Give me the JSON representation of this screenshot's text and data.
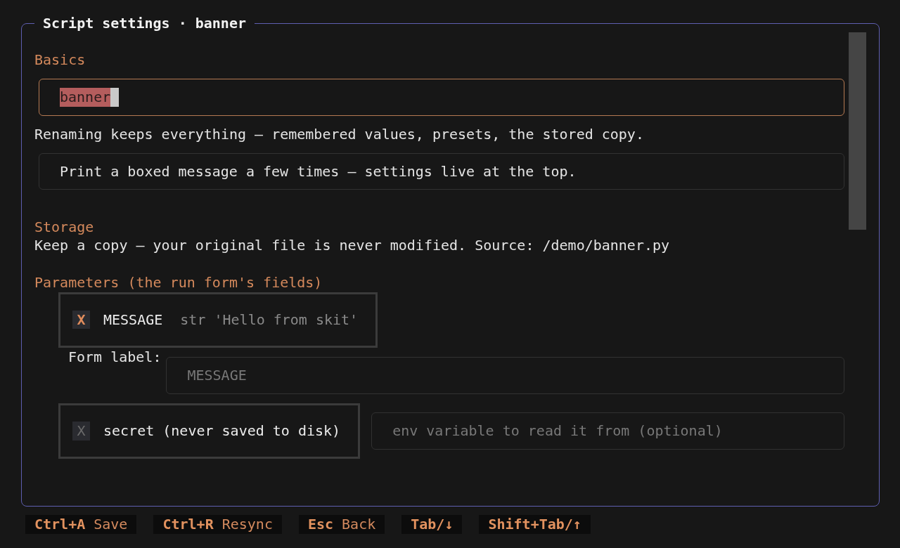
{
  "panel": {
    "title": "Script settings · banner"
  },
  "basics": {
    "heading": "Basics",
    "name_field": {
      "value": "banner",
      "focused": true,
      "text_selected": true
    },
    "rename_note": "Renaming keeps everything — remembered values, presets, the stored copy.",
    "description_field": {
      "value": "Print a boxed message a few times — settings live at the top.",
      "focused": false
    }
  },
  "storage": {
    "heading": "Storage",
    "note": "Keep a copy — your original file is never modified. Source: /demo/banner.py"
  },
  "parameters": {
    "heading": "Parameters (the run form's fields)",
    "items": [
      {
        "include": {
          "glyph": "X",
          "checked": true,
          "name": "MESSAGE",
          "hint": "str 'Hello from skit'"
        },
        "form_label": {
          "label": "Form label:",
          "placeholder": "MESSAGE"
        },
        "secret": {
          "glyph": "X",
          "checked": false,
          "label": "secret (never saved to disk)"
        },
        "env_field": {
          "placeholder": "env variable to read it from (optional)"
        }
      }
    ]
  },
  "footer": {
    "bindings": [
      {
        "key": "Ctrl+A",
        "action": "Save"
      },
      {
        "key": "Ctrl+R",
        "action": "Resync"
      },
      {
        "key": "Esc",
        "action": "Back"
      },
      {
        "key": "Tab/↓"
      },
      {
        "key": "Shift+Tab/↑"
      }
    ]
  }
}
